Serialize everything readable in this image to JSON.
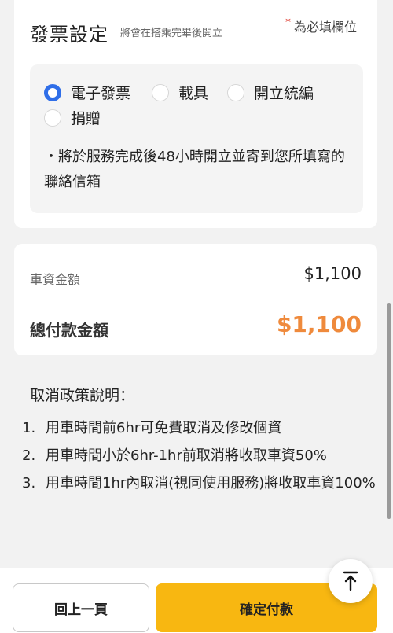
{
  "invoice": {
    "title": "發票設定",
    "note": "將會在搭乘完畢後開立",
    "required_star": "*",
    "required_text": "為必填欄位",
    "options": [
      {
        "label": "電子發票",
        "selected": true
      },
      {
        "label": "載具",
        "selected": false
      },
      {
        "label": "開立統編",
        "selected": false
      },
      {
        "label": "捐贈",
        "selected": false
      }
    ],
    "info": "・將於服務完成後48小時開立並寄到您所填寫的聯絡信箱"
  },
  "fare": {
    "fare_label": "車資金額",
    "fare_value": "$1,100",
    "total_label": "總付款金額",
    "total_value": "$1,100",
    "total_color": "#ef8a3c"
  },
  "policy": {
    "title": "取消政策說明：",
    "items": [
      {
        "num": "1.",
        "text": "用車時間前6hr可免費取消及修改個資"
      },
      {
        "num": "2.",
        "text": "用車時間小於6hr-1hr前取消將收取車資50%"
      },
      {
        "num": "3.",
        "text": "用車時間1hr內取消(視同使用服務)將收取車資100%"
      }
    ]
  },
  "footer": {
    "back_label": "回上一頁",
    "confirm_label": "確定付款",
    "confirm_color": "#f8b711",
    "scroll_top_icon": "arrow-up-to-line-icon"
  },
  "colors": {
    "radio_selected": "#2f6ee8",
    "required_star": "#e0463a"
  }
}
